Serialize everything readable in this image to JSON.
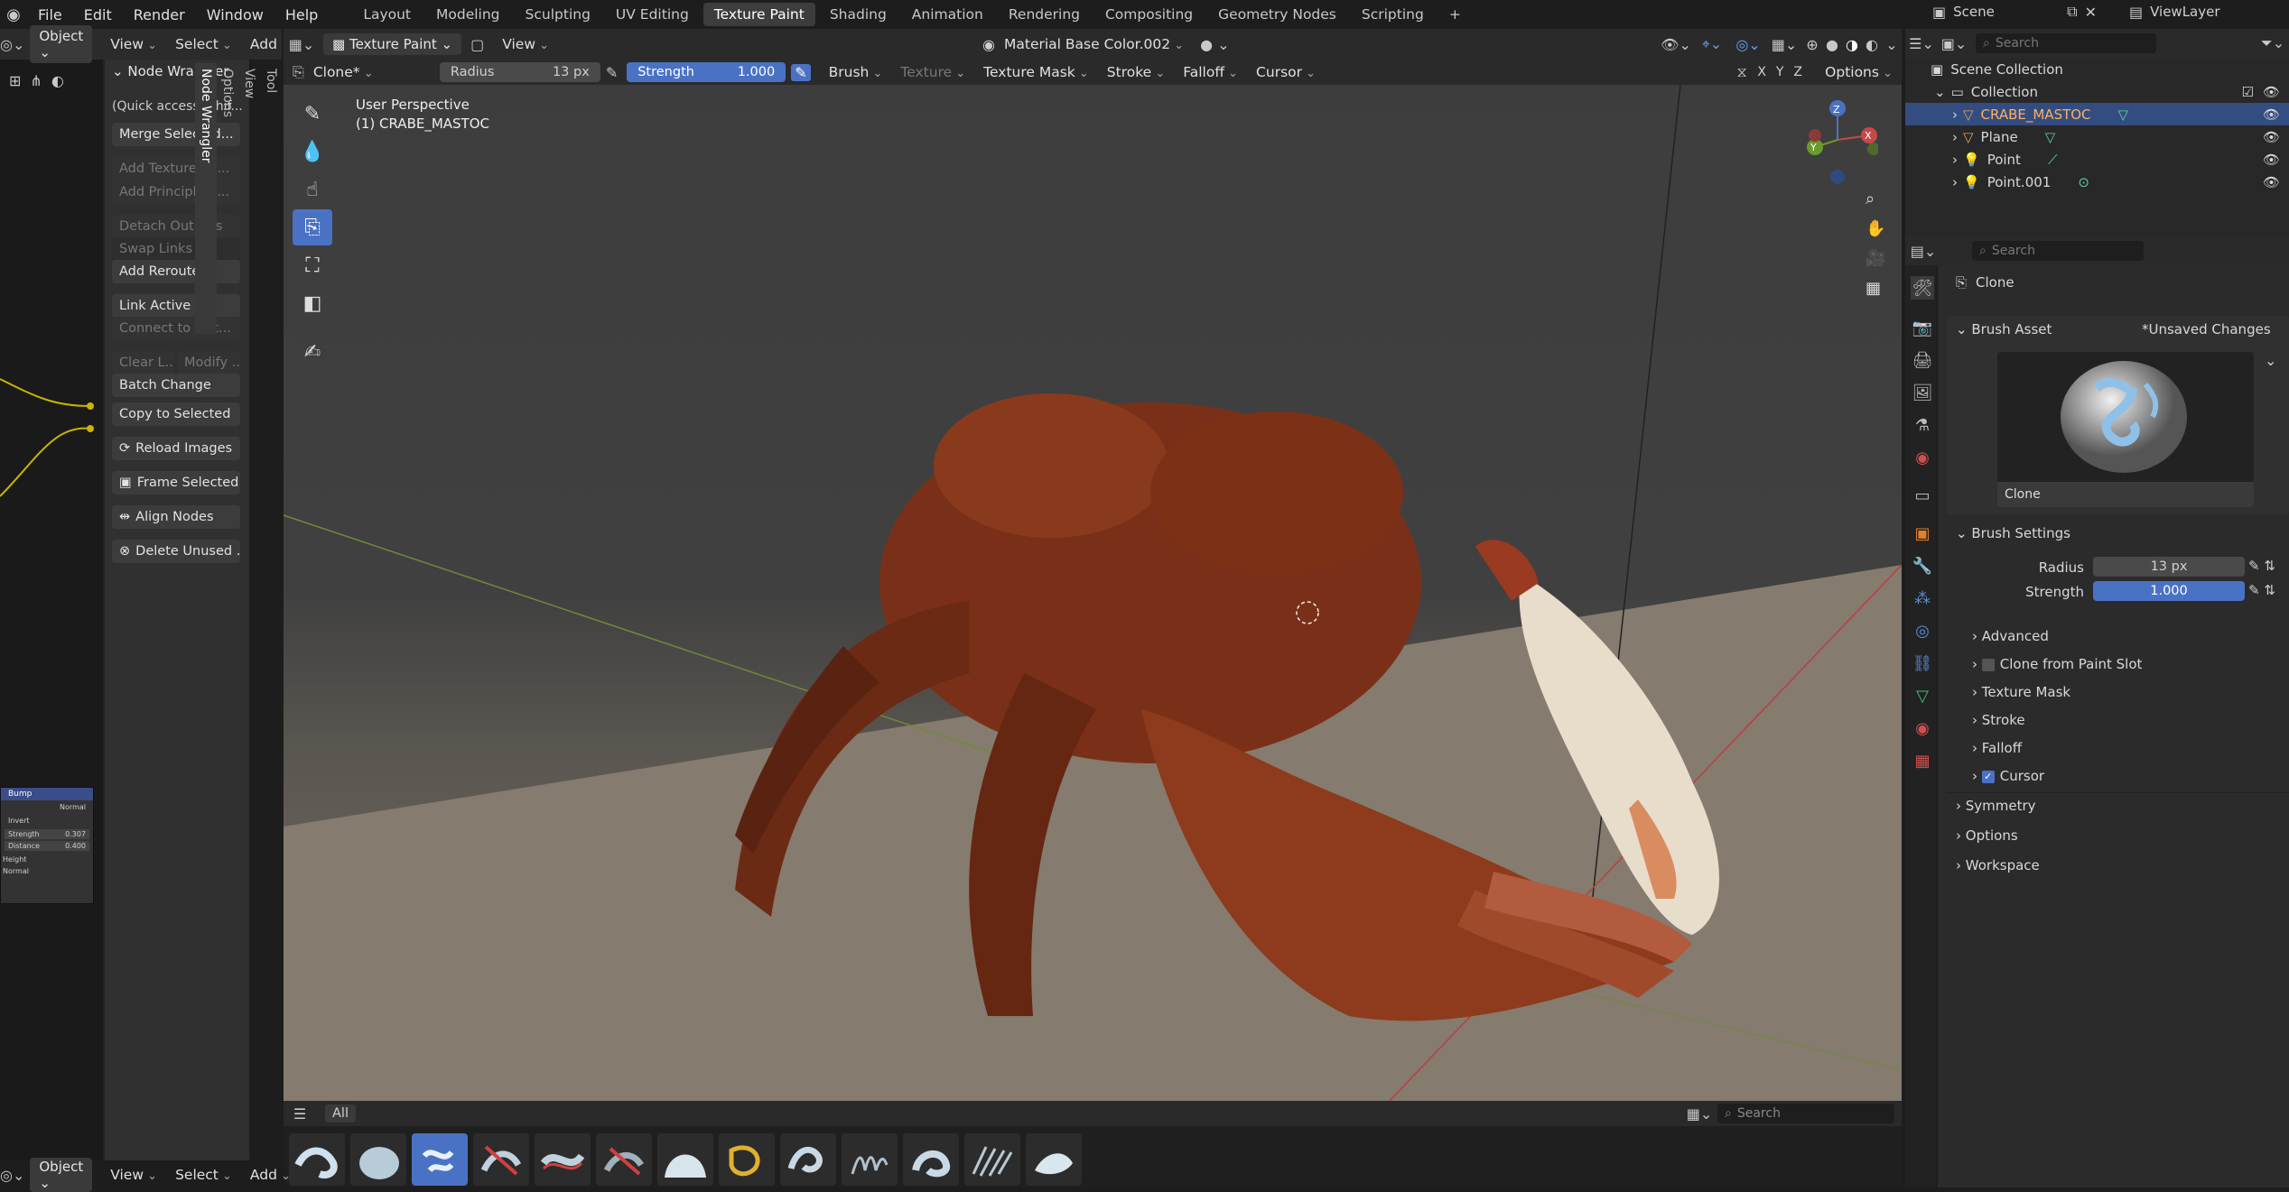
{
  "topbar": {
    "menus": [
      "File",
      "Edit",
      "Render",
      "Window",
      "Help"
    ],
    "workspaces": [
      "Layout",
      "Modeling",
      "Sculpting",
      "UV Editing",
      "Texture Paint",
      "Shading",
      "Animation",
      "Rendering",
      "Compositing",
      "Geometry Nodes",
      "Scripting"
    ],
    "active_workspace": "Texture Paint",
    "add": "+",
    "scene": "Scene",
    "view_layer": "ViewLayer"
  },
  "left_editor": {
    "mode": "Object",
    "view": "View",
    "select": "Select",
    "add": "Add"
  },
  "node_wrangler": {
    "title": "Node Wrangler",
    "quick": "(Quick access: Shif...",
    "merge": "Merge Selected...",
    "add_texture": "Add Texture Se...",
    "add_principled": "Add Principled ...",
    "detach": "Detach Outputs",
    "swap": "Swap Links",
    "add_reroutes": "Add Reroutes",
    "link_active": "Link Active t...",
    "connect_out": "Connect to Out...",
    "clear": "Clear L...",
    "modify": "Modify ...",
    "batch": "Batch Change",
    "copy": "Copy to Selected",
    "reload": "Reload Images",
    "frame": "Frame Selected",
    "align": "Align Nodes",
    "delete": "Delete Unused ..."
  },
  "sidebar_tabs": [
    "Tool",
    "View",
    "Options",
    "Node Wrangler"
  ],
  "node_card": {
    "title": "Bump",
    "mode": "Normal",
    "invert": "Invert",
    "strength_label": "Strength",
    "strength_val": "0.307",
    "distance_label": "Distance",
    "distance_val": "0.400",
    "height": "Height",
    "normal": "Normal"
  },
  "viewport_header": {
    "mode": "Texture Paint",
    "view": "View",
    "material": "Material Base Color.002"
  },
  "tool_header": {
    "brush_name": "Clone*",
    "radius_label": "Radius",
    "radius_val": "13 px",
    "strength_label": "Strength",
    "strength_val": "1.000",
    "brush": "Brush",
    "texture": "Texture",
    "texture_mask": "Texture Mask",
    "stroke": "Stroke",
    "falloff": "Falloff",
    "cursor": "Cursor",
    "options": "Options",
    "x": "X",
    "y": "Y",
    "z": "Z"
  },
  "viewport": {
    "perspective": "User Perspective",
    "object": "(1) CRABE_MASTOC"
  },
  "asset_shelf": {
    "tab": "All",
    "search_placeholder": "Search"
  },
  "outliner": {
    "search_placeholder": "Search",
    "scene_collection": "Scene Collection",
    "collection": "Collection",
    "items": [
      "CRABE_MASTOC",
      "Plane",
      "Point",
      "Point.001"
    ]
  },
  "properties": {
    "search_placeholder": "Search",
    "tool_name": "Clone",
    "brush_asset": "Brush Asset",
    "unsaved": "*Unsaved Changes",
    "preview_label": "Clone",
    "brush_settings": "Brush Settings",
    "radius_label": "Radius",
    "radius_val": "13 px",
    "strength_label": "Strength",
    "strength_val": "1.000",
    "advanced": "Advanced",
    "clone_from": "Clone from Paint Slot",
    "texture_mask": "Texture Mask",
    "stroke": "Stroke",
    "falloff": "Falloff",
    "cursor": "Cursor",
    "symmetry": "Symmetry",
    "options": "Options",
    "workspace": "Workspace"
  },
  "bottom": {
    "mode": "Object",
    "view": "View",
    "select": "Select",
    "add": "Add"
  }
}
